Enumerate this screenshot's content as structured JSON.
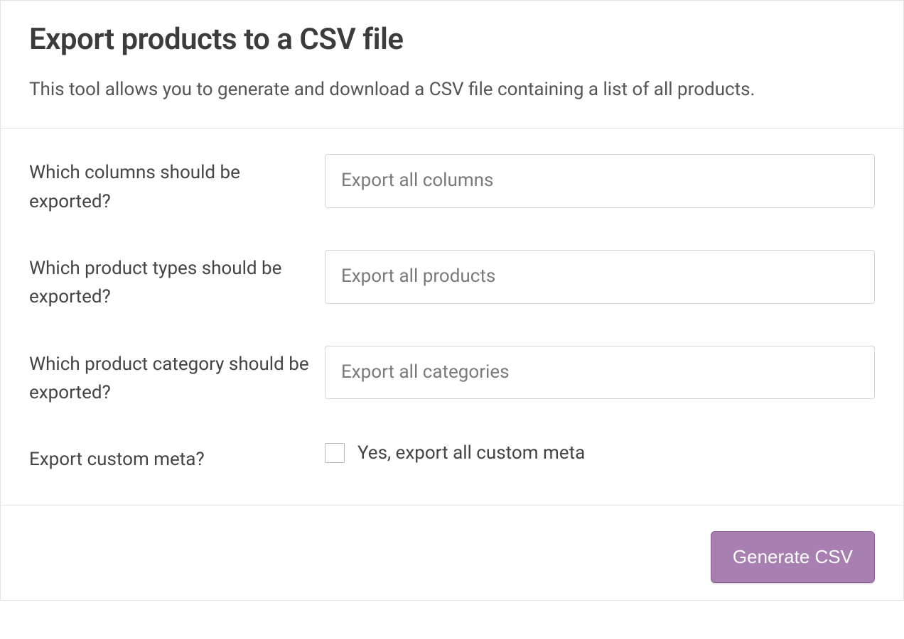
{
  "header": {
    "title": "Export products to a CSV file",
    "description": "This tool allows you to generate and download a CSV file containing a list of all products."
  },
  "fields": {
    "columns": {
      "label": "Which columns should be exported?",
      "placeholder": "Export all columns"
    },
    "productTypes": {
      "label": "Which product types should be exported?",
      "placeholder": "Export all products"
    },
    "productCategory": {
      "label": "Which product category should be exported?",
      "placeholder": "Export all categories"
    },
    "customMeta": {
      "label": "Export custom meta?",
      "checkboxLabel": "Yes, export all custom meta"
    }
  },
  "footer": {
    "submitLabel": "Generate CSV"
  }
}
